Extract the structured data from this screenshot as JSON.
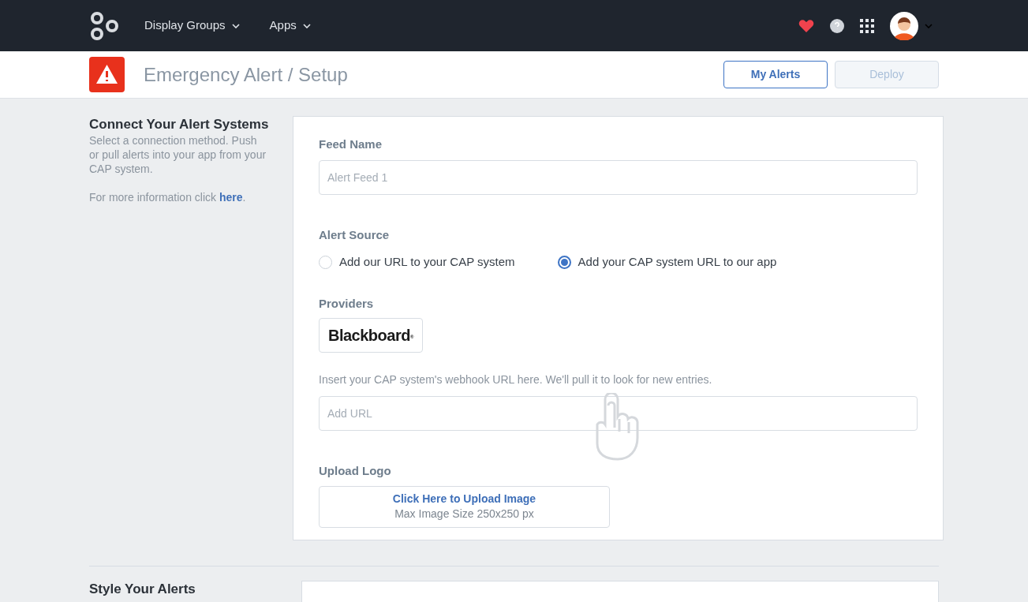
{
  "navbar": {
    "menus": [
      {
        "label": "Display Groups"
      },
      {
        "label": "Apps"
      }
    ]
  },
  "header": {
    "title": "Emergency Alert / Setup",
    "buttons": [
      {
        "label": "My Alerts",
        "disabled": false
      },
      {
        "label": "Deploy",
        "disabled": true
      }
    ]
  },
  "connect_section": {
    "title": "Connect Your Alert Systems",
    "description": "Select a connection method. Push or pull alerts into your app from your CAP system.",
    "info_before": "For more information click",
    "info_link": "here",
    "info_after": "."
  },
  "form": {
    "feed_name": {
      "label": "Feed Name",
      "placeholder": "Alert Feed 1"
    },
    "alert_source": {
      "label": "Alert Source",
      "options": [
        {
          "label": "Add our URL to your CAP system",
          "selected": false
        },
        {
          "label": "Add your CAP system URL to our app",
          "selected": true
        }
      ]
    },
    "providers": {
      "label": "Providers",
      "items": [
        {
          "label": "Blackboard",
          "mark": "®"
        }
      ]
    },
    "webhook": {
      "hint": "Insert your CAP system's webhook URL here. We'll pull it to look for new entries.",
      "placeholder": "Add URL"
    },
    "upload_logo": {
      "label": "Upload Logo",
      "link": "Click Here to Upload Image",
      "note": "Max Image Size 250x250 px"
    }
  },
  "style_section": {
    "title": "Style Your Alerts"
  }
}
